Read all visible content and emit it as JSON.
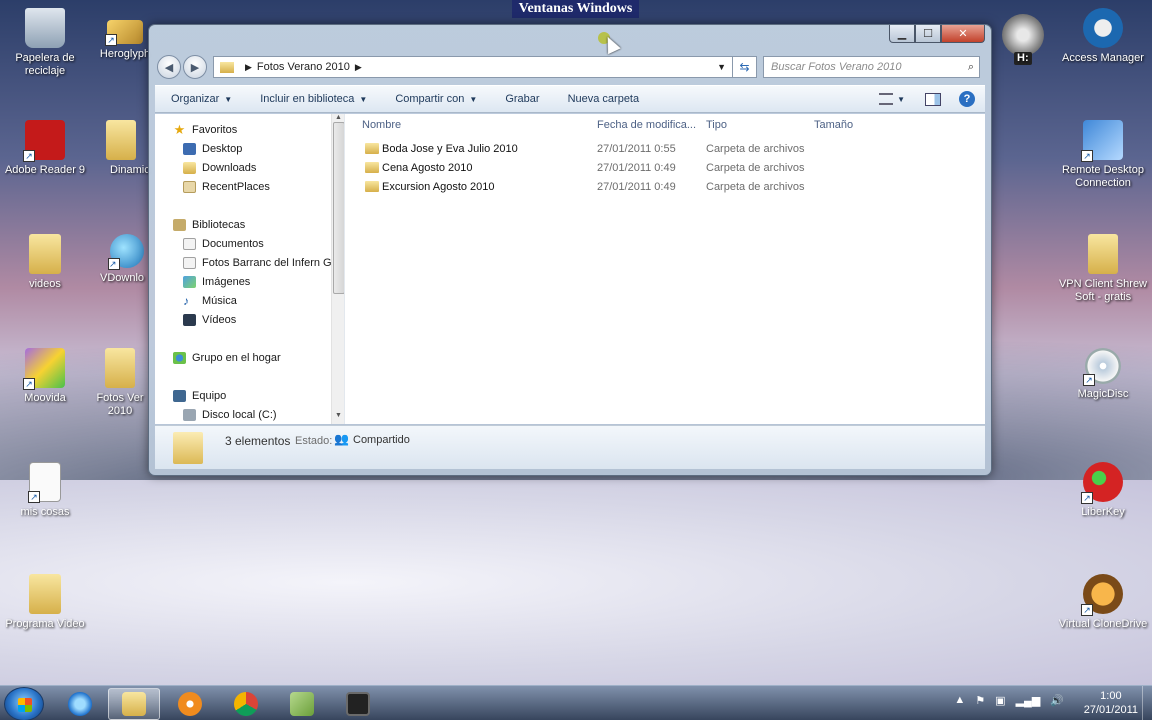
{
  "banner": "Ventanas Windows",
  "desktop_icons_left": [
    {
      "label": "Papelera de reciclaje"
    },
    {
      "label": "Heroglyph"
    },
    {
      "label": "Adobe Reader 9"
    },
    {
      "label": "Dinamic"
    },
    {
      "label": "videos"
    },
    {
      "label": "VDownlo"
    },
    {
      "label": "Moovida"
    },
    {
      "label": "Fotos Ver 2010"
    },
    {
      "label": "mis cosas"
    },
    {
      "label": "Programa Video"
    }
  ],
  "desktop_icons_right": [
    {
      "label": "Access Manager"
    },
    {
      "label": "Remote Desktop Connection"
    },
    {
      "label": "VPN Client Shrew Soft - gratis"
    },
    {
      "label": "MagicDisc"
    },
    {
      "label": "LiberKey"
    },
    {
      "label": "Virtual CloneDrive"
    },
    {
      "label": "H:"
    }
  ],
  "window": {
    "address_path": "Fotos Verano 2010",
    "search_placeholder": "Buscar Fotos Verano 2010",
    "toolbar": {
      "organize": "Organizar",
      "include_library": "Incluir en biblioteca",
      "share_with": "Compartir con",
      "burn": "Grabar",
      "new_folder": "Nueva carpeta"
    },
    "nav": {
      "favorites": "Favoritos",
      "desktop": "Desktop",
      "downloads": "Downloads",
      "recent": "RecentPlaces",
      "libraries": "Bibliotecas",
      "documents": "Documentos",
      "fotos_barranc": "Fotos Barranc del Infern Ger",
      "images": "Imágenes",
      "music": "Música",
      "videos": "Vídeos",
      "homegroup": "Grupo en el hogar",
      "computer": "Equipo",
      "local_disk": "Disco local (C:)"
    },
    "columns": {
      "name": "Nombre",
      "date": "Fecha de modifica...",
      "type": "Tipo",
      "size": "Tamaño"
    },
    "files": [
      {
        "name": "Boda Jose y Eva Julio 2010",
        "date": "27/01/2011 0:55",
        "type": "Carpeta de archivos"
      },
      {
        "name": "Cena Agosto 2010",
        "date": "27/01/2011 0:49",
        "type": "Carpeta de archivos"
      },
      {
        "name": "Excursion Agosto 2010",
        "date": "27/01/2011 0:49",
        "type": "Carpeta de archivos"
      }
    ],
    "details": {
      "count": "3 elementos",
      "state_label": "Estado:",
      "state_value": "Compartido"
    }
  },
  "taskbar": {
    "time": "1:00",
    "date": "27/01/2011"
  }
}
